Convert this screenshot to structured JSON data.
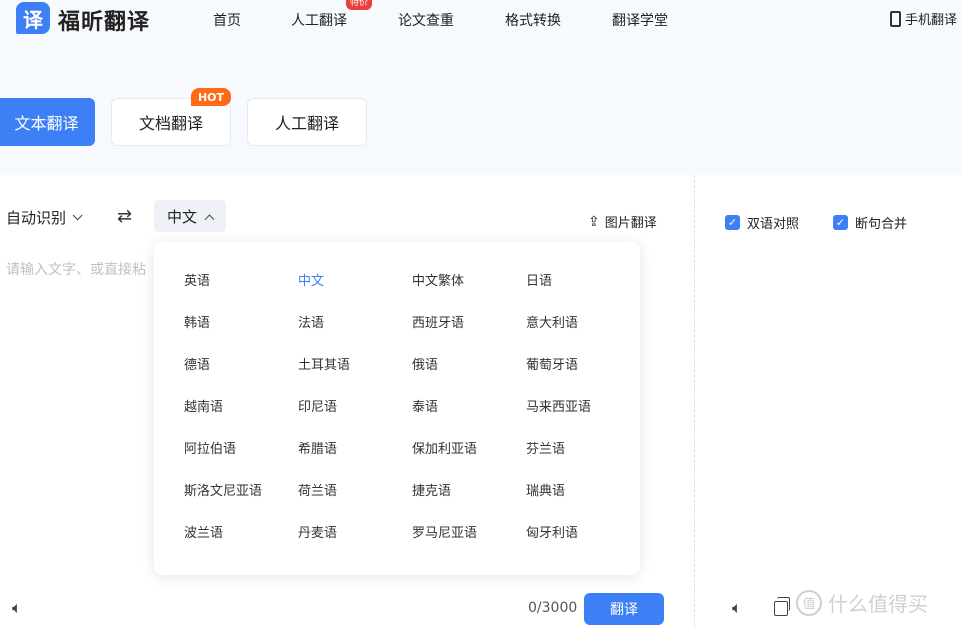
{
  "header": {
    "logo_char": "译",
    "logo_text": "福昕翻译",
    "nav": [
      {
        "label": "首页"
      },
      {
        "label": "人工翻译",
        "badge": "特价"
      },
      {
        "label": "论文查重"
      },
      {
        "label": "格式转换"
      },
      {
        "label": "翻译学堂"
      }
    ],
    "phone_label": "手机翻译"
  },
  "mode_tabs": [
    {
      "label": "文本翻译",
      "active": true
    },
    {
      "label": "文档翻译",
      "badge": "HOT"
    },
    {
      "label": "人工翻译"
    }
  ],
  "source_lang": "自动识别",
  "swap_icon": "swap-arrows-icon",
  "target_lang": "中文",
  "image_translate_label": "图片翻译",
  "input": {
    "placeholder": "请输入文字、或直接粘"
  },
  "dropdown": {
    "languages": [
      "英语",
      "中文",
      "中文繁体",
      "日语",
      "韩语",
      "法语",
      "西班牙语",
      "意大利语",
      "德语",
      "土耳其语",
      "俄语",
      "葡萄牙语",
      "越南语",
      "印尼语",
      "泰语",
      "马来西亚语",
      "阿拉伯语",
      "希腊语",
      "保加利亚语",
      "芬兰语",
      "斯洛文尼亚语",
      "荷兰语",
      "捷克语",
      "瑞典语",
      "波兰语",
      "丹麦语",
      "罗马尼亚语",
      "匈牙利语"
    ],
    "selected": "中文"
  },
  "bottom": {
    "char_count": "0/3000",
    "translate_label": "翻译"
  },
  "right_panel": {
    "bilingual_label": "双语对照",
    "merge_label": "断句合并"
  },
  "watermark": {
    "mark": "值",
    "text": "什么值得买"
  },
  "colors": {
    "accent": "#3d7ff5",
    "hot": "#ff6a15",
    "sale": "#e8403a"
  }
}
